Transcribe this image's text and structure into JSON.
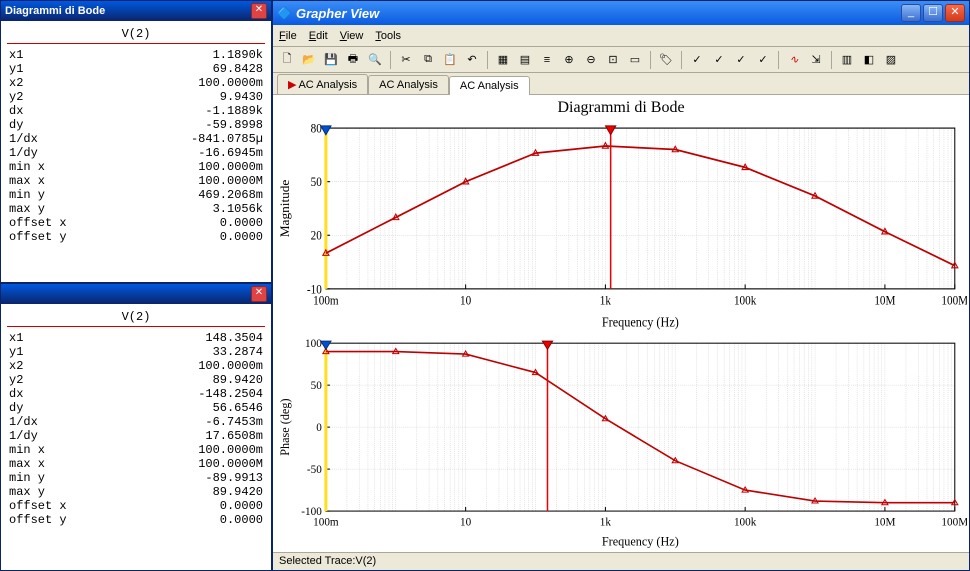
{
  "left_top": {
    "title": "Diagrammi di Bode",
    "header": "V(2)",
    "rows": [
      {
        "k": "x1",
        "v": "1.1890k"
      },
      {
        "k": "y1",
        "v": "69.8428"
      },
      {
        "k": "x2",
        "v": "100.0000m"
      },
      {
        "k": "y2",
        "v": "9.9430"
      },
      {
        "k": "dx",
        "v": "-1.1889k"
      },
      {
        "k": "dy",
        "v": "-59.8998"
      },
      {
        "k": "1/dx",
        "v": "-841.0785µ"
      },
      {
        "k": "1/dy",
        "v": "-16.6945m"
      },
      {
        "k": "min x",
        "v": "100.0000m"
      },
      {
        "k": "max x",
        "v": "100.0000M"
      },
      {
        "k": "min y",
        "v": "469.2068m"
      },
      {
        "k": "max y",
        "v": "3.1056k"
      },
      {
        "k": "offset x",
        "v": "0.0000"
      },
      {
        "k": "offset y",
        "v": "0.0000"
      }
    ]
  },
  "left_bottom": {
    "header": "V(2)",
    "rows": [
      {
        "k": "x1",
        "v": "148.3504"
      },
      {
        "k": "y1",
        "v": "33.2874"
      },
      {
        "k": "x2",
        "v": "100.0000m"
      },
      {
        "k": "y2",
        "v": "89.9420"
      },
      {
        "k": "dx",
        "v": "-148.2504"
      },
      {
        "k": "dy",
        "v": "56.6546"
      },
      {
        "k": "1/dx",
        "v": "-6.7453m"
      },
      {
        "k": "1/dy",
        "v": "17.6508m"
      },
      {
        "k": "min x",
        "v": "100.0000m"
      },
      {
        "k": "max x",
        "v": "100.0000M"
      },
      {
        "k": "min y",
        "v": "-89.9913"
      },
      {
        "k": "max y",
        "v": "89.9420"
      },
      {
        "k": "offset x",
        "v": "0.0000"
      },
      {
        "k": "offset y",
        "v": "0.0000"
      }
    ]
  },
  "grapher": {
    "title": "Grapher View",
    "menu": {
      "file": "File",
      "edit": "Edit",
      "view": "View",
      "tools": "Tools"
    },
    "tabs": [
      "AC Analysis",
      "AC Analysis",
      "AC Analysis"
    ],
    "active_tab": 2,
    "chart_title": "Diagrammi di Bode",
    "xlabel": "Frequency (Hz)",
    "ylabel_top": "Magnitude",
    "ylabel_bottom": "Phase (deg)",
    "status": "Selected Trace:V(2)"
  },
  "chart_data": [
    {
      "type": "line",
      "title": "Diagrammi di Bode",
      "ylabel": "Magnitude",
      "xlabel": "Frequency (Hz)",
      "x_scale": "log",
      "xlim": [
        0.1,
        100000000
      ],
      "ylim": [
        -10,
        80
      ],
      "x_ticks": [
        "100m",
        "10",
        "1k",
        "100k",
        "10M",
        "100M"
      ],
      "y_ticks": [
        -10,
        20,
        50,
        80
      ],
      "x": [
        0.1,
        1,
        10,
        100,
        1000,
        10000,
        100000,
        1000000,
        10000000,
        100000000
      ],
      "y": [
        10,
        30,
        50,
        66,
        70,
        68,
        58,
        42,
        22,
        3
      ],
      "cursor_x": 1189,
      "cursor2_x": 0.1,
      "color": "#c00000"
    },
    {
      "type": "line",
      "ylabel": "Phase (deg)",
      "xlabel": "Frequency (Hz)",
      "x_scale": "log",
      "xlim": [
        0.1,
        100000000
      ],
      "ylim": [
        -100,
        100
      ],
      "x_ticks": [
        "100m",
        "10",
        "1k",
        "100k",
        "10M",
        "100M"
      ],
      "y_ticks": [
        -100,
        -50,
        0,
        50,
        100
      ],
      "x": [
        0.1,
        1,
        10,
        100,
        1000,
        10000,
        100000,
        1000000,
        10000000,
        100000000
      ],
      "y": [
        90,
        90,
        87,
        65,
        10,
        -40,
        -75,
        -88,
        -90,
        -90
      ],
      "cursor_x": 148.35,
      "cursor2_x": 0.1,
      "color": "#c00000"
    }
  ]
}
